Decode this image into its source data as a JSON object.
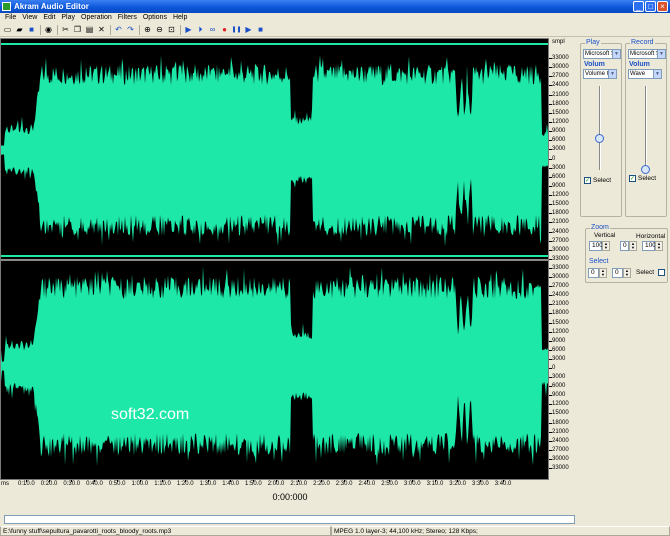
{
  "window": {
    "title": "Akram Audio Editor",
    "controls": {
      "minimize": "_",
      "maximize": "□",
      "close": "×"
    }
  },
  "menu": [
    "File",
    "View",
    "Edit",
    "Play",
    "Operation",
    "Filters",
    "Options",
    "Help"
  ],
  "toolbar": {
    "buttons": [
      {
        "name": "new-file-icon",
        "glyph": "▭"
      },
      {
        "name": "open-folder-icon",
        "glyph": "▰"
      },
      {
        "name": "save-icon",
        "glyph": "■"
      },
      {
        "name": "properties-icon",
        "glyph": "◉"
      },
      {
        "name": "cut-icon",
        "glyph": "✂"
      },
      {
        "name": "copy-icon",
        "glyph": "❐"
      },
      {
        "name": "paste-icon",
        "glyph": "▤"
      },
      {
        "name": "delete-icon",
        "glyph": "✕"
      },
      {
        "name": "undo-icon",
        "glyph": "↶"
      },
      {
        "name": "redo-icon",
        "glyph": "↷"
      },
      {
        "name": "zoom-in-icon",
        "glyph": "⊕"
      },
      {
        "name": "zoom-out-icon",
        "glyph": "⊖"
      },
      {
        "name": "zoom-selection-icon",
        "glyph": "⊡"
      },
      {
        "name": "play-icon",
        "glyph": "▶"
      },
      {
        "name": "play-from-start-icon",
        "glyph": "⏵"
      },
      {
        "name": "loop-icon",
        "glyph": "∞"
      },
      {
        "name": "record-icon",
        "glyph": "●"
      },
      {
        "name": "pause-icon",
        "glyph": "❚❚"
      },
      {
        "name": "play-selection-icon",
        "glyph": "▶"
      },
      {
        "name": "stop-icon",
        "glyph": "■"
      }
    ]
  },
  "waveform": {
    "fill_color": "#1de8a8",
    "background": "#000000",
    "scale_header": "smpl",
    "amplitude_labels": [
      "33000",
      "30000",
      "27000",
      "24000",
      "21000",
      "18000",
      "15000",
      "12000",
      "9000",
      "6000",
      "3000",
      "0",
      "3000",
      "6000",
      "9000",
      "12000",
      "15000",
      "18000",
      "21000",
      "24000",
      "27000",
      "30000",
      "33000"
    ],
    "time_labels": [
      "ms",
      "0:10.0",
      "0:20.0",
      "0:30.0",
      "0:40.0",
      "0:50.0",
      "1:00.0",
      "1:10.0",
      "1:20.0",
      "1:30.0",
      "1:40.0",
      "1:50.0",
      "2:00.0",
      "2:10.0",
      "2:20.0",
      "2:30.0",
      "2:40.0",
      "2:50.0",
      "3:00.0",
      "3:10.0",
      "3:20.0",
      "3:30.0",
      "3:40.0"
    ],
    "watermark": "soft32.com"
  },
  "position_display": "0:00:000",
  "play_panel": {
    "title": "Play",
    "device": "Microsoft S",
    "volume_label": "Volum",
    "volume_select": "Volume C",
    "select_label": "Select",
    "select_checked": true,
    "check_glyph": "✓"
  },
  "record_panel": {
    "title": "Record",
    "device": "Microsoft S",
    "volume_label": "Volum",
    "volume_select": "Wave",
    "select_label": "Select",
    "select_checked": true,
    "check_glyph": "✓"
  },
  "zoom_panel": {
    "title": "Zoom",
    "vertical_label": "Vertical",
    "horizontal_label": "Horizontal",
    "vertical_value": "100",
    "vertical_zero": "0",
    "horizontal_zero": "0",
    "horizontal_value": "100"
  },
  "select_panel": {
    "title": "Select",
    "start": "0",
    "end": "0",
    "select_label": "Select"
  },
  "status": {
    "file_path": "E:\\funny stuff\\sepultura_pavarotti_roots_bloody_roots.mp3",
    "format": "MPEG 1.0 layer-3; 44,100 kHz; Stereo; 128 Kbps;"
  }
}
